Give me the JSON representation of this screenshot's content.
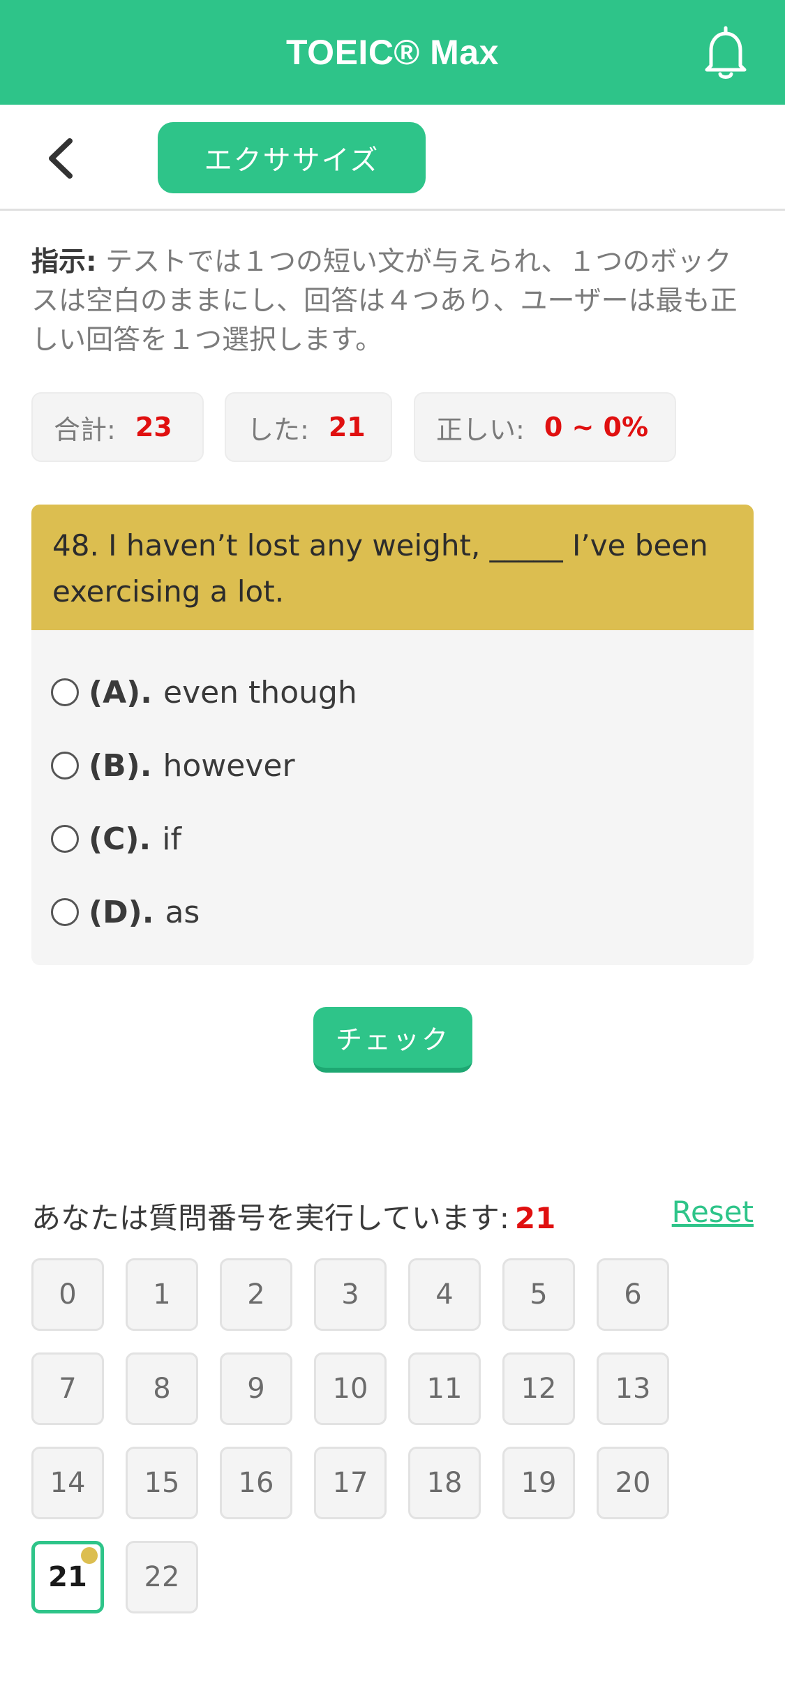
{
  "header": {
    "title": "TOEIC® Max",
    "bell_icon": "bell-icon"
  },
  "subbar": {
    "back_icon": "chevron-left-icon",
    "mode_label": "エクササイズ"
  },
  "instructions": {
    "label": "指示:",
    "text": " テストでは１つの短い文が与えられ、１つのボックスは空白のままにし、回答は４つあり、ユーザーは最も正しい回答を１つ選択します。"
  },
  "stats": {
    "total_label": "合計:",
    "total_value": "23",
    "done_label": "した:",
    "done_value": "21",
    "correct_label": "正しい:",
    "correct_value": "0 ~ 0%"
  },
  "question": {
    "text": "48. I haven’t lost any weight, _____ I’ve been exercising a lot.",
    "options": [
      {
        "letter": "(A).",
        "text": "even though"
      },
      {
        "letter": "(B).",
        "text": "however"
      },
      {
        "letter": "(C).",
        "text": "if"
      },
      {
        "letter": "(D).",
        "text": "as"
      }
    ]
  },
  "check_label": "チェック",
  "progress": {
    "label": "あなたは質問番号を実行しています:",
    "current": "21",
    "reset_label": "Reset"
  },
  "question_numbers": [
    "0",
    "1",
    "2",
    "3",
    "4",
    "5",
    "6",
    "7",
    "8",
    "9",
    "10",
    "11",
    "12",
    "13",
    "14",
    "15",
    "16",
    "17",
    "18",
    "19",
    "20",
    "21",
    "22"
  ],
  "active_question": "21",
  "colors": {
    "brand_green": "#2ec489",
    "question_header": "#dcbe50",
    "highlight_red": "#e01010"
  }
}
